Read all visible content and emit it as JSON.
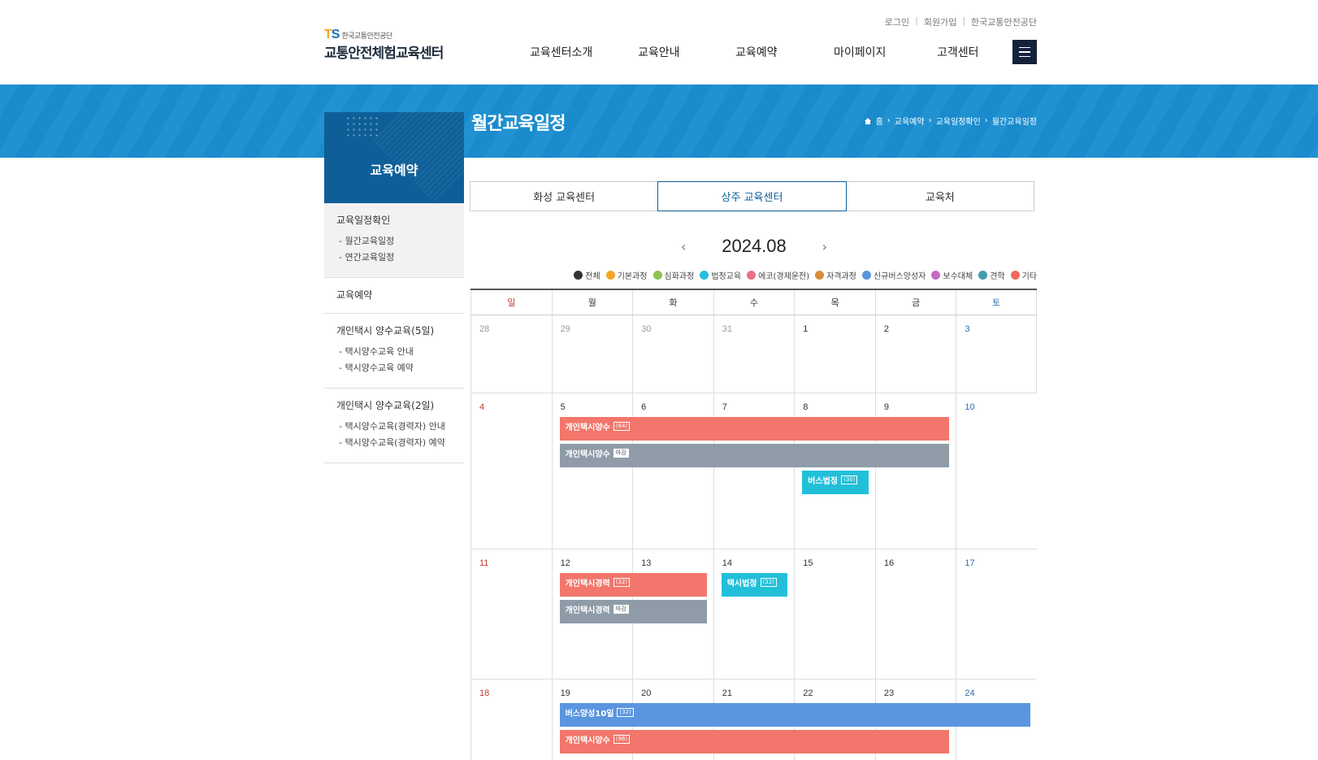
{
  "util_links": [
    "로그인",
    "회원가입",
    "한국교통안전공단"
  ],
  "logo": {
    "org": "한국교통안전공단",
    "site": "교통안전체험교육센터"
  },
  "gnb": [
    "교육센터소개",
    "교육안내",
    "교육예약",
    "마이페이지",
    "고객센터"
  ],
  "page_title": "월간교육일정",
  "breadcrumb": [
    "홈",
    "교육예약",
    "교육일정확인",
    "월간교육일정"
  ],
  "side": {
    "title": "교육예약",
    "groups": [
      {
        "title": "교육일정확인",
        "subs": [
          "- 월간교육일정",
          "- 연간교육일정"
        ]
      },
      {
        "title": "교육예약",
        "subs": []
      },
      {
        "title": "개인택시 양수교육(5일)",
        "subs": [
          "- 택시양수교육 안내",
          "- 택시양수교육 예약"
        ]
      },
      {
        "title": "개인택시 양수교육(2일)",
        "subs": [
          "- 택시양수교육(경력자) 안내",
          "- 택시양수교육(경력자) 예약"
        ]
      }
    ]
  },
  "tabs": [
    "화성 교육센터",
    "상주 교육센터",
    "교육처"
  ],
  "month": "2024.08",
  "legend": [
    {
      "label": "전체",
      "color": "#333333"
    },
    {
      "label": "기본과정",
      "color": "#f5a623"
    },
    {
      "label": "심화과정",
      "color": "#8cc152"
    },
    {
      "label": "법정교육",
      "color": "#22bfd9"
    },
    {
      "label": "에코(경제운전)",
      "color": "#e87283"
    },
    {
      "label": "자격과정",
      "color": "#d98c3a"
    },
    {
      "label": "신규버스양성자",
      "color": "#5a95e0"
    },
    {
      "label": "보수대체",
      "color": "#c86bc0"
    },
    {
      "label": "견학",
      "color": "#3f9cae"
    },
    {
      "label": "기타",
      "color": "#f0685c"
    }
  ],
  "weekdays": [
    "일",
    "월",
    "화",
    "수",
    "목",
    "금",
    "토"
  ],
  "weeks": [
    {
      "days": [
        "28",
        "29",
        "30",
        "31",
        "1",
        "2",
        "3"
      ],
      "other": [
        0,
        1,
        2,
        3
      ]
    },
    {
      "days": [
        "4",
        "5",
        "6",
        "7",
        "8",
        "9",
        "10"
      ],
      "other": []
    },
    {
      "days": [
        "11",
        "12",
        "13",
        "14",
        "15",
        "16",
        "17"
      ],
      "other": []
    },
    {
      "days": [
        "18",
        "19",
        "20",
        "21",
        "22",
        "23",
        "24"
      ],
      "other": []
    }
  ],
  "events": [
    {
      "week": 1,
      "start": 1,
      "span": 5,
      "lane": 0,
      "label": "개인택시양수",
      "badge": "(64)",
      "color": "#f2766b",
      "closed": false
    },
    {
      "week": 1,
      "start": 1,
      "span": 5,
      "lane": 1,
      "label": "개인택시양수",
      "badge": "마감",
      "color": "#8f9ca8",
      "closed": true
    },
    {
      "week": 1,
      "start": 4,
      "span": 1,
      "lane": 2,
      "label": "버스법정",
      "badge": "(30)",
      "color": "#22bfd9",
      "closed": false
    },
    {
      "week": 2,
      "start": 1,
      "span": 2,
      "lane": 0,
      "label": "개인택시경력",
      "badge": "(32)",
      "color": "#f2766b",
      "closed": false
    },
    {
      "week": 2,
      "start": 1,
      "span": 2,
      "lane": 1,
      "label": "개인택시경력",
      "badge": "마감",
      "color": "#8f9ca8",
      "closed": true
    },
    {
      "week": 2,
      "start": 3,
      "span": 1,
      "lane": 0,
      "label": "택시법정",
      "badge": "(32)",
      "color": "#22bfd9",
      "closed": false
    },
    {
      "week": 3,
      "start": 1,
      "span": 6,
      "lane": 0,
      "label": "버스양성10일",
      "badge": "(32)",
      "color": "#5a95e0",
      "closed": false
    },
    {
      "week": 3,
      "start": 1,
      "span": 5,
      "lane": 1,
      "label": "개인택시양수",
      "badge": "(96)",
      "color": "#f2766b",
      "closed": false
    }
  ]
}
